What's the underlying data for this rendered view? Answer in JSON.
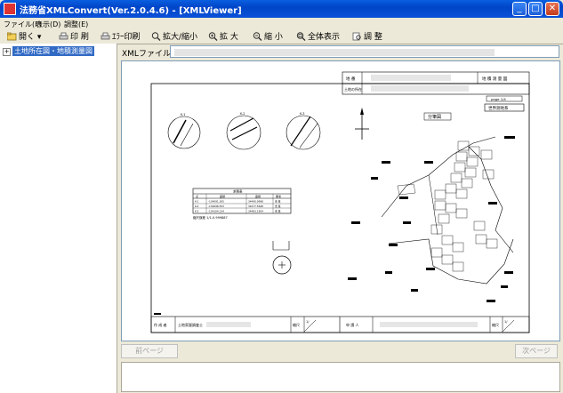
{
  "window": {
    "title": "法務省XMLConvert(Ver.2.0.4.6) - [XMLViewer]",
    "minimize": "_",
    "maximize": "□",
    "close": "✕"
  },
  "menu": [
    {
      "label": "ファイル(F)"
    },
    {
      "label": "表示(D)"
    },
    {
      "label": "調整(E)"
    }
  ],
  "toolbar": {
    "open": "開く",
    "print": "印 刷",
    "error_print": "ｴﾗｰ印刷",
    "zoom_toggle": "拡大/縮小",
    "zoom_in": "拡 大",
    "zoom_out": "縮 小",
    "fit": "全体表示",
    "adjust": "調 整"
  },
  "tree": {
    "expander": "+",
    "root_label": "土地所在図・地積測量図"
  },
  "address": {
    "label": "XMLファイル"
  },
  "nav": {
    "prev": "前ページ",
    "next": "次ページ"
  },
  "drawing": {
    "top_labels": [
      "地 番",
      "地 積 測 量 図"
    ],
    "owner_label": "土地の所在",
    "page_label": "page 1/4",
    "map_type": "世界測地系",
    "map_title": "分筆図",
    "scale_label": "縮尺",
    "scale_value": "1/",
    "bottom_left_label": "作 成 者",
    "bottom_left_value": "土地家屋調査士",
    "bottom_right_label": "申 請 人",
    "table_title": "求積表",
    "table_headers": [
      "点",
      "座標",
      "座標",
      "備考"
    ],
    "table_rows": [
      [
        "K-1",
        "-134091.305",
        "34490.9998",
        "金 属"
      ],
      [
        "K-2",
        "-134098.553",
        "34477.5648",
        "金 属"
      ],
      [
        "K-3",
        "-134104.134",
        "34483.1954",
        "金 属"
      ]
    ],
    "table_footer": "縮尺誤差 1/1-0.999887",
    "detail_labels": [
      "K-1",
      "K-2",
      "K-3"
    ]
  }
}
